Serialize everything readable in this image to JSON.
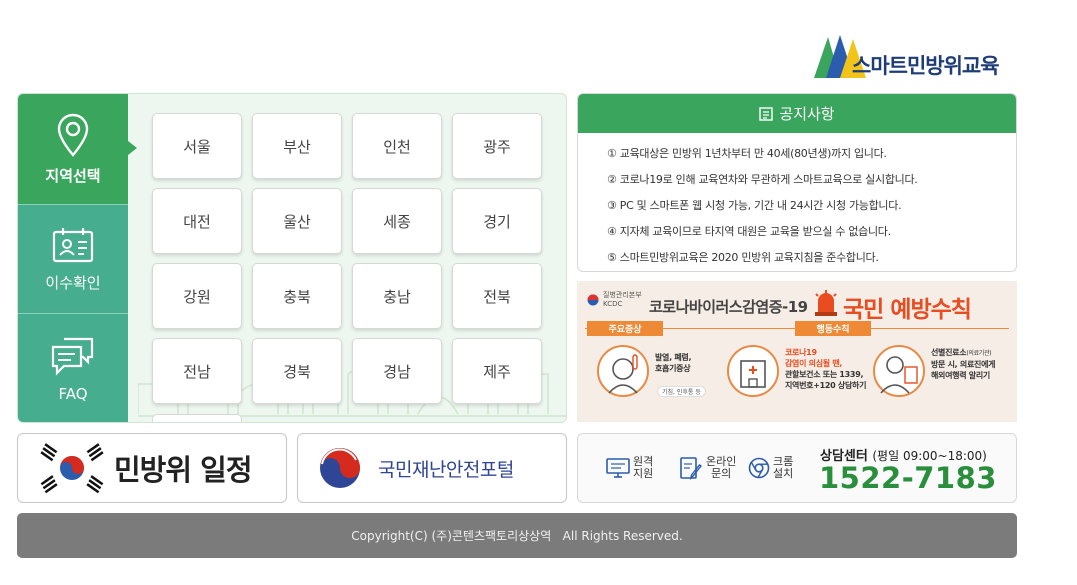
{
  "logo": {
    "text": "스마트민방위교육"
  },
  "side_nav": [
    {
      "label": "지역선택",
      "icon": "location-pin-icon"
    },
    {
      "label": "이수확인",
      "icon": "id-card-icon"
    },
    {
      "label": "FAQ",
      "icon": "chat-bubbles-icon"
    }
  ],
  "regions": [
    "서울",
    "부산",
    "인천",
    "광주",
    "대전",
    "울산",
    "세종",
    "경기",
    "강원",
    "충북",
    "충남",
    "전북",
    "전남",
    "경북",
    "경남",
    "제주"
  ],
  "notice": {
    "title": "공지사항",
    "items": [
      "① 교육대상은 민방위 1년차부터 만 40세(80년생)까지 입니다.",
      "② 코로나19로 인해 교육연차와 무관하게 스마트교육으로 실시합니다.",
      "③ PC 및 스마트폰 웹 시청 가능, 기간 내 24시간 시청 가능합니다.",
      "④ 지자체 교육이므로 타지역 대원은 교육을 받으실 수 없습니다.",
      "⑤ 스마트민방위교육은 2020 민방위 교육지침을 준수합니다."
    ]
  },
  "corona": {
    "agency_line1": "질병관리본부",
    "agency_line2": "KCDC",
    "title": "코로나바이러스감염증-19",
    "title2": "국민 예방수칙",
    "tag1": "주요증상",
    "tag2": "행동수칙",
    "symptoms_1": "발열, 폐렴,",
    "symptoms_2": "호흡기증상",
    "symptoms_sub": "기침, 인후통 등",
    "action1_1": "코로나19",
    "action1_2": "감염이 의심될 땐,",
    "action1_3": "관할보건소 또는 1339,",
    "action1_4": "지역번호+120 상담하기",
    "action2_1": "선별진료소",
    "action2_1b": "(의료기관)",
    "action2_2": "방문 시, 의료진에게",
    "action2_3": "해외여행력 알리기"
  },
  "banners": {
    "schedule": "민방위 일정",
    "portal": "국민재난안전포털"
  },
  "support": {
    "items": [
      {
        "label": "원격\n지원",
        "icon": "monitor-icon"
      },
      {
        "label": "온라인\n문의",
        "icon": "document-pen-icon"
      },
      {
        "label": "크롬\n설치",
        "icon": "chrome-icon"
      }
    ],
    "center_title": "상담센터",
    "hours": "(평일 09:00~18:00)",
    "phone": "1522-7183"
  },
  "footer": {
    "copyright": "Copyright(C) (주)콘텐츠팩토리상상역   All Rights Reserved."
  },
  "colors": {
    "primary_green": "#3aa55c",
    "teal": "#47ad8f",
    "phone_green": "#2a8f3c",
    "footer_gray": "#7b7b7b"
  }
}
